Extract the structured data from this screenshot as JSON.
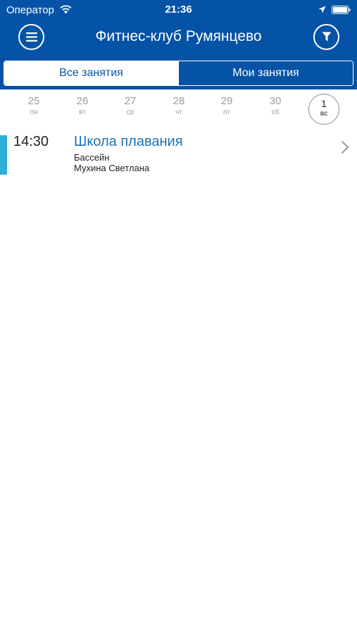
{
  "status": {
    "carrier": "Оператор",
    "time": "21:36",
    "icons": [
      "wifi-icon",
      "location-icon",
      "battery-icon"
    ]
  },
  "nav": {
    "title": "Фитнес-клуб Румянцево",
    "menu_icon": "hamburger-menu-icon",
    "filter_icon": "filter-funnel-icon"
  },
  "tabs": [
    {
      "label": "Все занятия",
      "active": true
    },
    {
      "label": "Мои занятия",
      "active": false
    }
  ],
  "days": [
    {
      "num": "25",
      "wd": "пн"
    },
    {
      "num": "26",
      "wd": "вт"
    },
    {
      "num": "27",
      "wd": "ср"
    },
    {
      "num": "28",
      "wd": "чт"
    },
    {
      "num": "29",
      "wd": "пт"
    },
    {
      "num": "30",
      "wd": "сб"
    },
    {
      "num": "1",
      "wd": "вс",
      "selected": true
    }
  ],
  "sessions": [
    {
      "time": "14:30",
      "title": "Школа плавания",
      "room": "Бассейн",
      "trainer": "Мухина Светлана"
    }
  ],
  "colors": {
    "brand": "#0553a7",
    "accent": "#2eaed8",
    "link": "#1a73b8"
  }
}
